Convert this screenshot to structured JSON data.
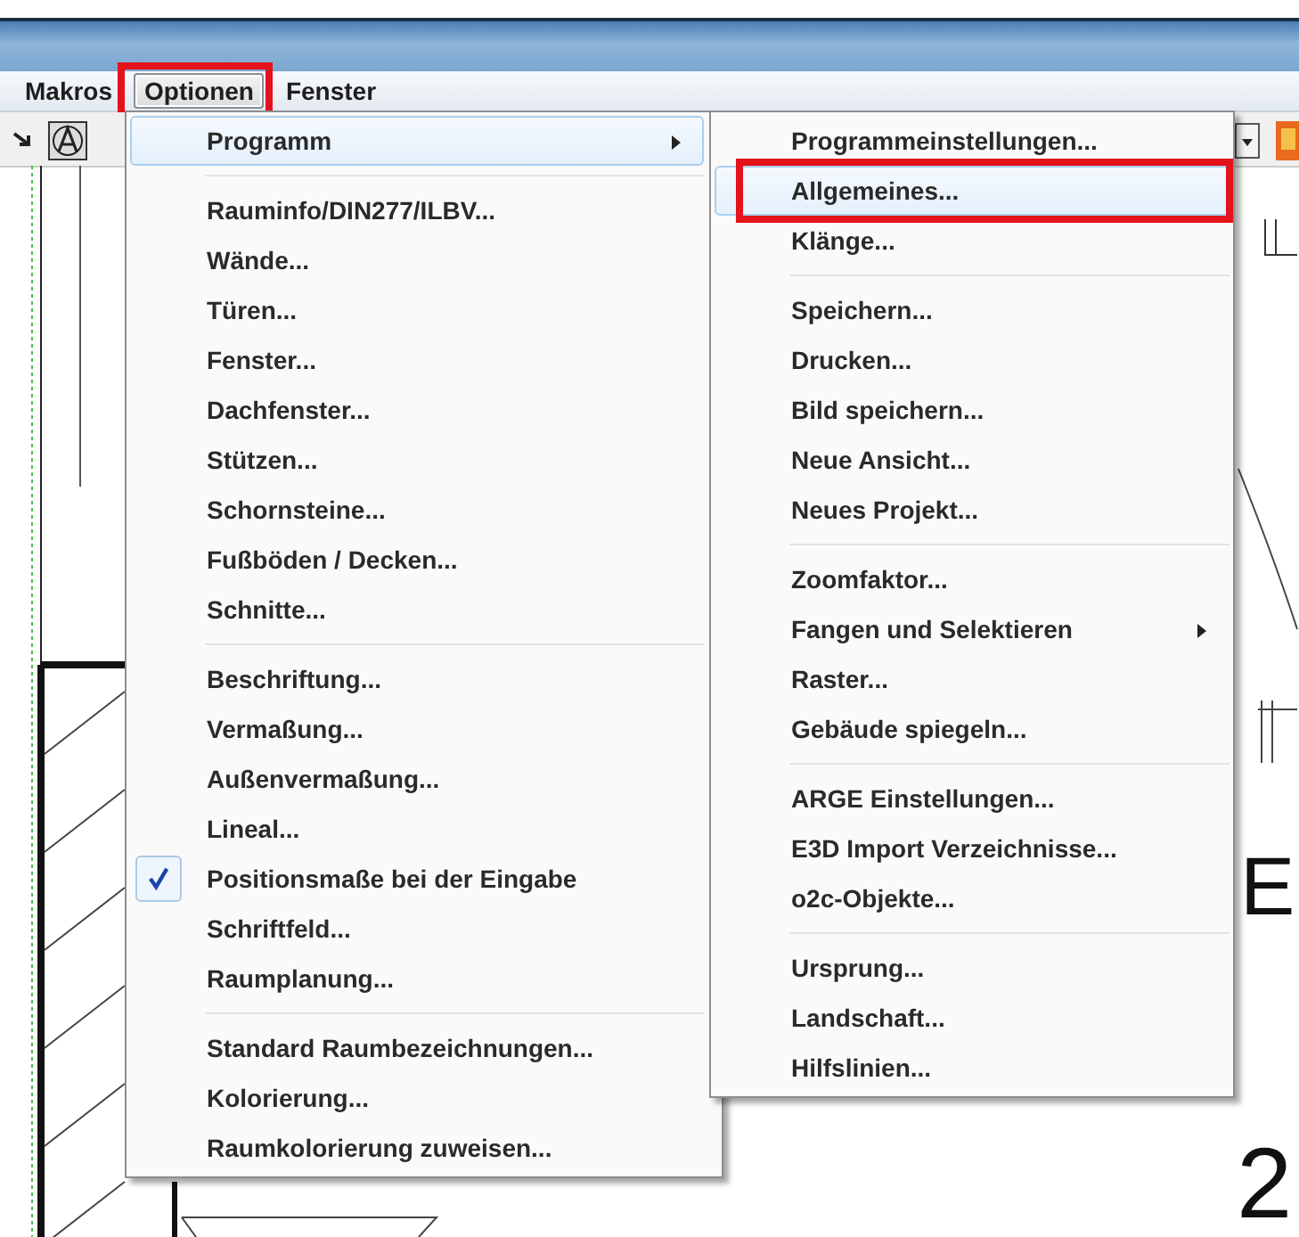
{
  "menubar": [
    {
      "label": "Makros",
      "selected": false,
      "annotated": false
    },
    {
      "label": "Optionen",
      "selected": true,
      "annotated": true
    },
    {
      "label": "Fenster",
      "selected": false,
      "annotated": false
    }
  ],
  "menu": {
    "groups": [
      [
        {
          "label": "Programm",
          "kind": "submenu",
          "selected": true,
          "checked": false,
          "annotated": false
        }
      ],
      [
        {
          "label": "Rauminfo/DIN277/ILBV...",
          "kind": "command",
          "selected": false,
          "checked": false,
          "annotated": false
        },
        {
          "label": "Wände...",
          "kind": "command",
          "selected": false,
          "checked": false,
          "annotated": false
        },
        {
          "label": "Türen...",
          "kind": "command",
          "selected": false,
          "checked": false,
          "annotated": false
        },
        {
          "label": "Fenster...",
          "kind": "command",
          "selected": false,
          "checked": false,
          "annotated": false
        },
        {
          "label": "Dachfenster...",
          "kind": "command",
          "selected": false,
          "checked": false,
          "annotated": false
        },
        {
          "label": "Stützen...",
          "kind": "command",
          "selected": false,
          "checked": false,
          "annotated": false
        },
        {
          "label": "Schornsteine...",
          "kind": "command",
          "selected": false,
          "checked": false,
          "annotated": false
        },
        {
          "label": "Fußböden / Decken...",
          "kind": "command",
          "selected": false,
          "checked": false,
          "annotated": false
        },
        {
          "label": "Schnitte...",
          "kind": "command",
          "selected": false,
          "checked": false,
          "annotated": false
        }
      ],
      [
        {
          "label": "Beschriftung...",
          "kind": "command",
          "selected": false,
          "checked": false,
          "annotated": false
        },
        {
          "label": "Vermaßung...",
          "kind": "command",
          "selected": false,
          "checked": false,
          "annotated": false
        },
        {
          "label": "Außenvermaßung...",
          "kind": "command",
          "selected": false,
          "checked": false,
          "annotated": false
        },
        {
          "label": "Lineal...",
          "kind": "command",
          "selected": false,
          "checked": false,
          "annotated": false
        },
        {
          "label": "Positionsmaße bei der Eingabe",
          "kind": "command",
          "selected": false,
          "checked": true,
          "annotated": false
        },
        {
          "label": "Schriftfeld...",
          "kind": "command",
          "selected": false,
          "checked": false,
          "annotated": false
        },
        {
          "label": "Raumplanung...",
          "kind": "command",
          "selected": false,
          "checked": false,
          "annotated": false
        }
      ],
      [
        {
          "label": "Standard Raumbezeichnungen...",
          "kind": "command",
          "selected": false,
          "checked": false,
          "annotated": false
        },
        {
          "label": "Kolorierung...",
          "kind": "command",
          "selected": false,
          "checked": false,
          "annotated": false
        },
        {
          "label": "Raumkolorierung zuweisen...",
          "kind": "command",
          "selected": false,
          "checked": false,
          "annotated": false
        }
      ]
    ]
  },
  "submenu": {
    "groups": [
      [
        {
          "label": "Programmeinstellungen...",
          "kind": "command",
          "selected": false,
          "checked": false,
          "annotated": false
        },
        {
          "label": "Allgemeines...",
          "kind": "command",
          "selected": true,
          "checked": false,
          "annotated": true
        },
        {
          "label": "Klänge...",
          "kind": "command",
          "selected": false,
          "checked": false,
          "annotated": false
        }
      ],
      [
        {
          "label": "Speichern...",
          "kind": "command",
          "selected": false,
          "checked": false,
          "annotated": false
        },
        {
          "label": "Drucken...",
          "kind": "command",
          "selected": false,
          "checked": false,
          "annotated": false
        },
        {
          "label": "Bild speichern...",
          "kind": "command",
          "selected": false,
          "checked": false,
          "annotated": false
        },
        {
          "label": "Neue Ansicht...",
          "kind": "command",
          "selected": false,
          "checked": false,
          "annotated": false
        },
        {
          "label": "Neues Projekt...",
          "kind": "command",
          "selected": false,
          "checked": false,
          "annotated": false
        }
      ],
      [
        {
          "label": "Zoomfaktor...",
          "kind": "command",
          "selected": false,
          "checked": false,
          "annotated": false
        },
        {
          "label": "Fangen und Selektieren",
          "kind": "submenu",
          "selected": false,
          "checked": false,
          "annotated": false
        },
        {
          "label": "Raster...",
          "kind": "command",
          "selected": false,
          "checked": false,
          "annotated": false
        },
        {
          "label": "Gebäude spiegeln...",
          "kind": "command",
          "selected": false,
          "checked": false,
          "annotated": false
        }
      ],
      [
        {
          "label": "ARGE Einstellungen...",
          "kind": "command",
          "selected": false,
          "checked": false,
          "annotated": false
        },
        {
          "label": "E3D Import Verzeichnisse...",
          "kind": "command",
          "selected": false,
          "checked": false,
          "annotated": false
        },
        {
          "label": "o2c-Objekte...",
          "kind": "command",
          "selected": false,
          "checked": false,
          "annotated": false
        }
      ],
      [
        {
          "label": "Ursprung...",
          "kind": "command",
          "selected": false,
          "checked": false,
          "annotated": false
        },
        {
          "label": "Landschaft...",
          "kind": "command",
          "selected": false,
          "checked": false,
          "annotated": false
        },
        {
          "label": "Hilfslinien...",
          "kind": "command",
          "selected": false,
          "checked": false,
          "annotated": false
        }
      ]
    ]
  },
  "canvas_labels": [
    "E",
    "2"
  ]
}
